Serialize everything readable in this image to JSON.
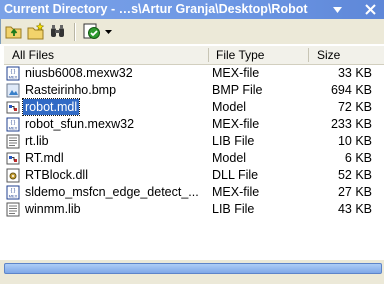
{
  "window": {
    "title": "Current Directory - …s\\Artur Granja\\Desktop\\Robot"
  },
  "toolbar": {
    "buttons": [
      {
        "icon": "folder-up-icon"
      },
      {
        "icon": "new-folder-icon"
      },
      {
        "icon": "find-icon"
      },
      {
        "icon": "visdiff-check-icon"
      },
      {
        "icon": "dropdown-arrow-icon"
      }
    ]
  },
  "columns": {
    "name": "All Files",
    "type": "File Type",
    "size": "Size"
  },
  "files": [
    {
      "name": "niusb6008.mexw32",
      "type": "MEX-file",
      "size": "33 KB",
      "icon": "mex-icon",
      "selected": false
    },
    {
      "name": "Rasteirinho.bmp",
      "type": "BMP File",
      "size": "694 KB",
      "icon": "bmp-icon",
      "selected": false
    },
    {
      "name": "robot.mdl",
      "type": "Model",
      "size": "72 KB",
      "icon": "model-icon",
      "selected": true
    },
    {
      "name": "robot_sfun.mexw32",
      "type": "MEX-file",
      "size": "233 KB",
      "icon": "mex-icon",
      "selected": false
    },
    {
      "name": "rt.lib",
      "type": "LIB File",
      "size": "10 KB",
      "icon": "lib-icon",
      "selected": false
    },
    {
      "name": "RT.mdl",
      "type": "Model",
      "size": "6 KB",
      "icon": "model-icon",
      "selected": false
    },
    {
      "name": "RTBlock.dll",
      "type": "DLL File",
      "size": "52 KB",
      "icon": "dll-icon",
      "selected": false
    },
    {
      "name": "sldemo_msfcn_edge_detect_...",
      "type": "MEX-file",
      "size": "27 KB",
      "icon": "mex-icon",
      "selected": false
    },
    {
      "name": "winmm.lib",
      "type": "LIB File",
      "size": "43 KB",
      "icon": "lib-icon",
      "selected": false
    }
  ]
}
